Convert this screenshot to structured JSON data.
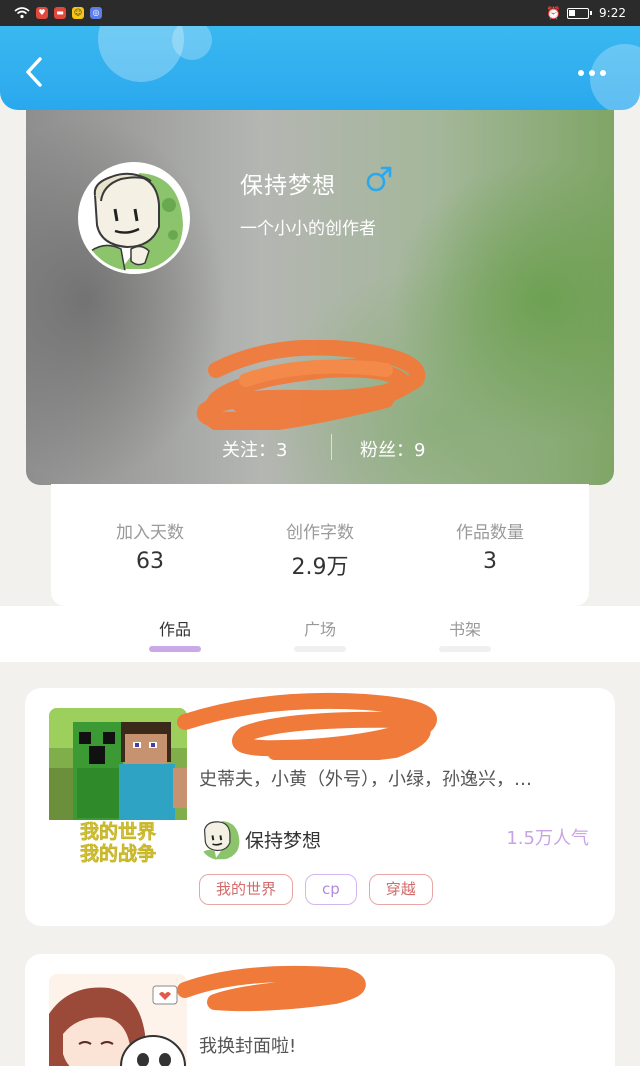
{
  "status_bar": {
    "time": "9:22",
    "icons": [
      "wifi-icon",
      "app-icon-red",
      "app-icon-red2",
      "app-icon-yellow",
      "app-icon-blue",
      "alarm-icon",
      "battery-icon"
    ]
  },
  "header": {
    "back_icon": "chevron-left-icon",
    "more_icon": "more-dots-icon",
    "accent_color": "#2aa8ee"
  },
  "profile": {
    "username": "保持梦想",
    "gender_icon": "male-icon",
    "gender_color": "#2aa8ee",
    "bio": "一个小小的创作者",
    "following_label": "关注：",
    "following_count": "3",
    "followers_label": "粉丝：",
    "followers_count": "9"
  },
  "stats": [
    {
      "label": "加入天数",
      "value": "63"
    },
    {
      "label": "创作字数",
      "value": "2.9万"
    },
    {
      "label": "作品数量",
      "value": "3"
    }
  ],
  "tabs": [
    {
      "label": "作品",
      "active": true
    },
    {
      "label": "广场",
      "active": false
    },
    {
      "label": "书架",
      "active": false
    }
  ],
  "works": [
    {
      "cover_text_1": "我的世界",
      "cover_text_2": "我的战争",
      "description": "史蒂夫，小黄（外号），小绿，孙逸兴，…",
      "author": "保持梦想",
      "popularity": "1.5万人气",
      "tags": [
        "我的世界",
        "cp",
        "穿越"
      ]
    },
    {
      "description": "我换封面啦!"
    }
  ]
}
